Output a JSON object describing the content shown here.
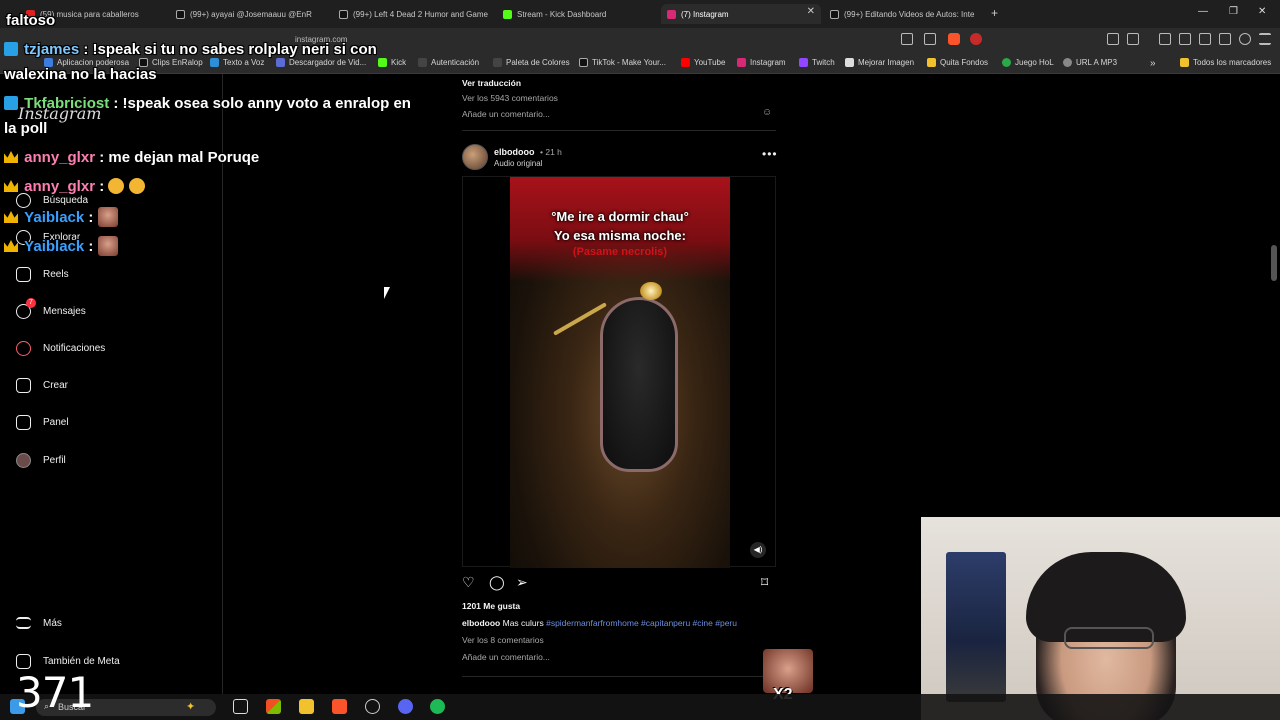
{
  "tabs": [
    {
      "label": "(59) musica para caballeros",
      "color": "#e02020"
    },
    {
      "label": "(99+) ayayai @Josemaauu @EnR",
      "color": "#111111"
    },
    {
      "label": "(99+) Left 4 Dead 2 Humor and Game",
      "color": "#111111"
    },
    {
      "label": "Stream - Kick Dashboard",
      "color": "#53fc18"
    },
    {
      "label": "(7) Instagram",
      "color": "#d62976"
    },
    {
      "label": "(99+) Editando Videos de Autos: Inte",
      "color": "#111111"
    }
  ],
  "url": "instagram.com",
  "bookmarks": [
    {
      "label": "Aplicacion poderosa",
      "color": "#3c7de0"
    },
    {
      "label": "Clips EnRalop",
      "color": "#111111"
    },
    {
      "label": "Texto a Voz",
      "color": "#2d8fd8"
    },
    {
      "label": "Descargador de Vid...",
      "color": "#5b6cd6"
    },
    {
      "label": "Kick",
      "color": "#53fc18"
    },
    {
      "label": "Autenticación",
      "color": "#444444"
    },
    {
      "label": "Paleta de Colores",
      "color": "#444444"
    },
    {
      "label": "TikTok - Make Your...",
      "color": "#111111"
    },
    {
      "label": "YouTube",
      "color": "#ff0000"
    },
    {
      "label": "Instagram",
      "color": "#d62976"
    },
    {
      "label": "Twitch",
      "color": "#9146ff"
    },
    {
      "label": "Mejorar Imagen",
      "color": "#dddddd"
    },
    {
      "label": "Quita Fondos",
      "color": "#f2c12e"
    },
    {
      "label": "Juego HoL",
      "color": "#2aa84a"
    },
    {
      "label": "URL A MP3",
      "color": "#888888"
    },
    {
      "label": "Todos los marcadores",
      "color": "#f2c12e"
    }
  ],
  "sidebar": {
    "logo": "Instagram",
    "items": [
      {
        "label": "Búsqueda",
        "icon": "search-icon"
      },
      {
        "label": "Explorar",
        "icon": "compass-icon"
      },
      {
        "label": "Reels",
        "icon": "reels-icon"
      },
      {
        "label": "Mensajes",
        "icon": "messenger-icon",
        "badge": "7"
      },
      {
        "label": "Notificaciones",
        "icon": "heart-icon"
      },
      {
        "label": "Crear",
        "icon": "plus-square-icon"
      },
      {
        "label": "Panel",
        "icon": "chart-icon"
      },
      {
        "label": "Perfil",
        "icon": "avatar-icon"
      },
      {
        "label": "Más",
        "icon": "menu-icon"
      },
      {
        "label": "También de Meta",
        "icon": "meta-icon"
      }
    ]
  },
  "feed": {
    "prev_translation": "Ver traducción",
    "prev_comments": "Ver los 5943 comentarios",
    "prev_add_comment": "Añade un comentario...",
    "post": {
      "username": "elbodooo",
      "time": "• 21 h",
      "audio": "Audio original",
      "caption_top": "°Me ire a dormir chau°",
      "caption_mid": "Yo esa misma noche:",
      "caption_red": "(Pasame necrolis)",
      "likes": "1201 Me gusta",
      "caption_user": "elbodooo",
      "caption_text": "Mas culurs",
      "caption_tags": "#spidermanfarfromhome #capitanperu #cine #peru",
      "view_comments": "Ver los 8 comentarios",
      "add_comment": "Añade un comentario..."
    }
  },
  "chat": [
    {
      "user": "faltoso",
      "text": "",
      "color": "#ffffff"
    },
    {
      "user": "tzjames",
      "text": ": !speak si tu no sabes rolplay neri si con",
      "cont": "walexina no la hacias",
      "color": "#7ec8ff"
    },
    {
      "user": "Tkfabriciost",
      "text": ": !speak osea solo anny voto a enralop en",
      "cont": "la poll",
      "color": "#7be07b"
    },
    {
      "user": "anny_glxr",
      "text": ": me dejan mal Poruqe",
      "color": "#ff7fb2"
    },
    {
      "user": "anny_glxr",
      "text": ":",
      "color": "#ff7fb2"
    },
    {
      "user": "Yaiblack",
      "text": ":",
      "color": "#3aa0ff"
    },
    {
      "user": "Yaiblack",
      "text": ":",
      "color": "#3aa0ff"
    }
  ],
  "overlay": {
    "counter": "371",
    "sticker_label": "X2"
  },
  "taskbar": {
    "search_label": "Buscar"
  }
}
